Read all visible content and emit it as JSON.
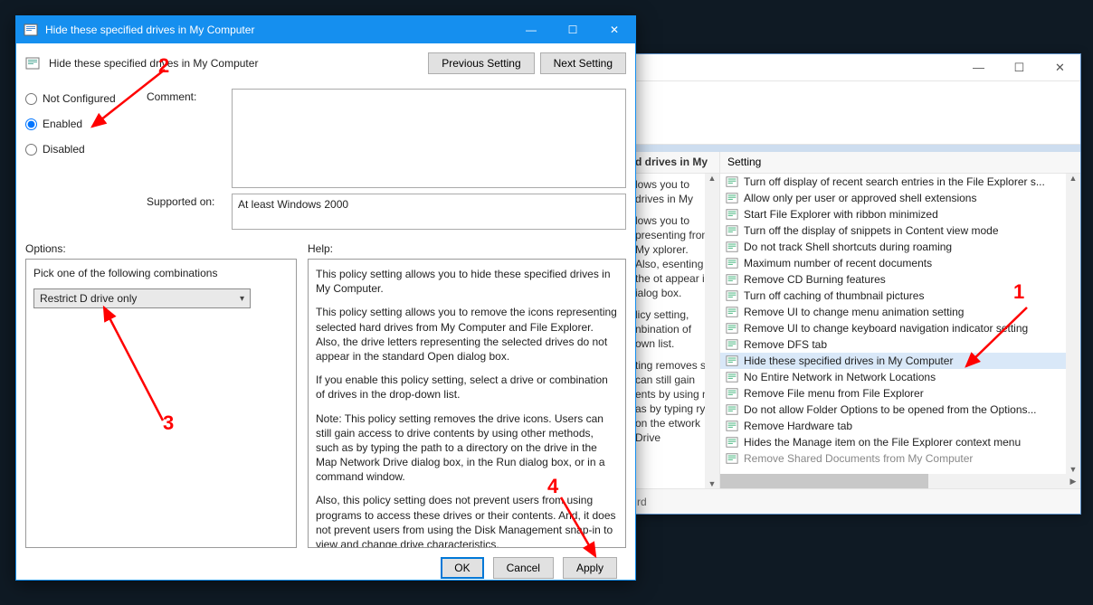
{
  "dialog": {
    "window_title": "Hide these specified drives in My Computer",
    "header_title": "Hide these specified drives in My Computer",
    "prev_btn": "Previous Setting",
    "next_btn": "Next Setting",
    "radio_not_configured": "Not Configured",
    "radio_enabled": "Enabled",
    "radio_disabled": "Disabled",
    "selected_radio": "enabled",
    "comment_label": "Comment:",
    "comment_value": "",
    "supported_label": "Supported on:",
    "supported_value": "At least Windows 2000",
    "options_label": "Options:",
    "help_label": "Help:",
    "option_caption": "Pick one of the following combinations",
    "option_value": "Restrict D drive only",
    "help_paragraphs": [
      "This policy setting allows you to hide these specified drives in My Computer.",
      "This policy setting allows you to remove the icons representing selected hard drives from My Computer and File Explorer. Also, the drive letters representing the selected drives do not appear in the standard Open dialog box.",
      "If you enable this policy setting, select a drive or combination of drives in the drop-down list.",
      "Note: This policy setting removes the drive icons. Users can still gain access to drive contents by using other methods, such as by typing the path to a directory on the drive in the Map Network Drive dialog box, in the Run dialog box, or in a command window.",
      "Also, this policy setting does not prevent users from using programs to access these drives or their contents. And, it does not prevent users from using the Disk Management snap-in to view and change drive characteristics."
    ],
    "ok_btn": "OK",
    "cancel_btn": "Cancel",
    "apply_btn": "Apply"
  },
  "back_window": {
    "left_header": "d drives in My",
    "left_text_lines": [
      "lows you to drives in My",
      "lows you to presenting from My xplorer. Also, esenting the ot appear in ialog box.",
      "licy setting, nbination of own list.",
      "ting removes s can still gain ents by using n as by typing ry on the etwork Drive"
    ],
    "left_bottom": "rd",
    "right_header": "Setting",
    "settings": [
      "Turn off display of recent search entries in the File Explorer s...",
      "Allow only per user or approved shell extensions",
      "Start File Explorer with ribbon minimized",
      "Turn off the display of snippets in Content view mode",
      "Do not track Shell shortcuts during roaming",
      "Maximum number of recent documents",
      "Remove CD Burning features",
      "Turn off caching of thumbnail pictures",
      "Remove UI to change menu animation setting",
      "Remove UI to change keyboard navigation indicator setting",
      "Remove DFS tab",
      "Hide these specified drives in My Computer",
      "No Entire Network in Network Locations",
      "Remove File menu from File Explorer",
      "Do not allow Folder Options to be opened from the Options...",
      "Remove Hardware tab",
      "Hides the Manage item on the File Explorer context menu",
      "Remove Shared Documents from My Computer"
    ],
    "selected_index": 11
  },
  "annotations": {
    "n1": "1",
    "n2": "2",
    "n3": "3",
    "n4": "4"
  }
}
